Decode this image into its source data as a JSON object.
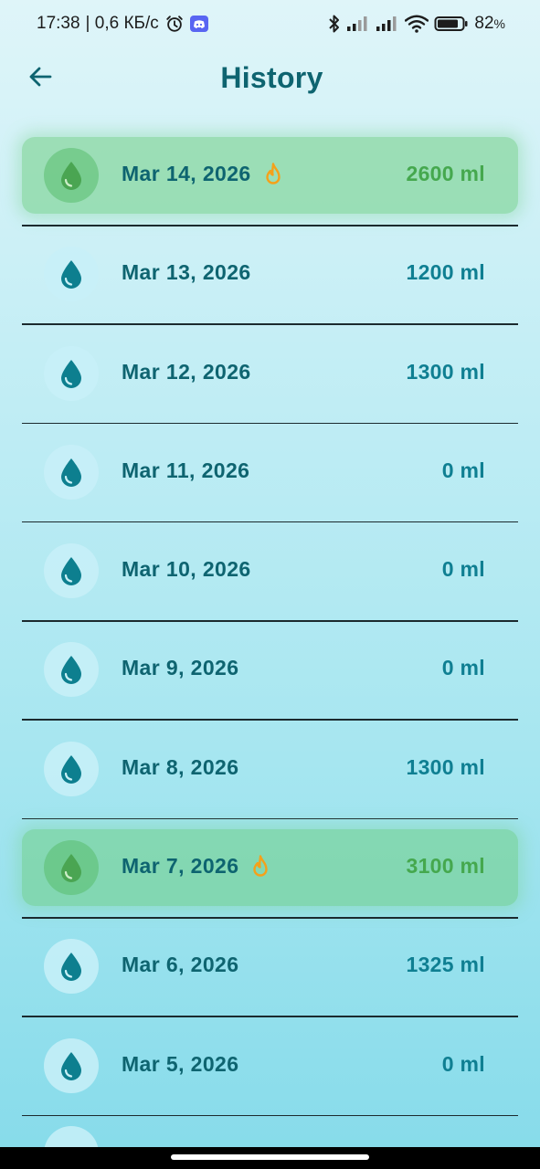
{
  "status_bar": {
    "time": "17:38",
    "speed": "| 0,6 КБ/с",
    "battery": "82",
    "battery_unit": "%"
  },
  "header": {
    "title": "History"
  },
  "colors": {
    "title": "#0e6470",
    "amount": "#0f7f92",
    "goal_amount": "#45a84e",
    "goal_row": "#7dcf8e",
    "flame": "#f5a11a"
  },
  "history": [
    {
      "date": "Mar 14, 2026",
      "amount": "2600 ml",
      "goal_met": true
    },
    {
      "date": "Mar 13, 2026",
      "amount": "1200 ml",
      "goal_met": false
    },
    {
      "date": "Mar 12, 2026",
      "amount": "1300 ml",
      "goal_met": false
    },
    {
      "date": "Mar 11, 2026",
      "amount": "0 ml",
      "goal_met": false
    },
    {
      "date": "Mar 10, 2026",
      "amount": "0 ml",
      "goal_met": false
    },
    {
      "date": "Mar 9, 2026",
      "amount": "0 ml",
      "goal_met": false
    },
    {
      "date": "Mar 8, 2026",
      "amount": "1300 ml",
      "goal_met": false
    },
    {
      "date": "Mar 7, 2026",
      "amount": "3100 ml",
      "goal_met": true
    },
    {
      "date": "Mar 6, 2026",
      "amount": "1325 ml",
      "goal_met": false
    },
    {
      "date": "Mar 5, 2026",
      "amount": "0 ml",
      "goal_met": false
    }
  ],
  "icons": {
    "back": "arrow-left-icon",
    "drop": "water-drop-icon",
    "streak": "flame-icon"
  }
}
